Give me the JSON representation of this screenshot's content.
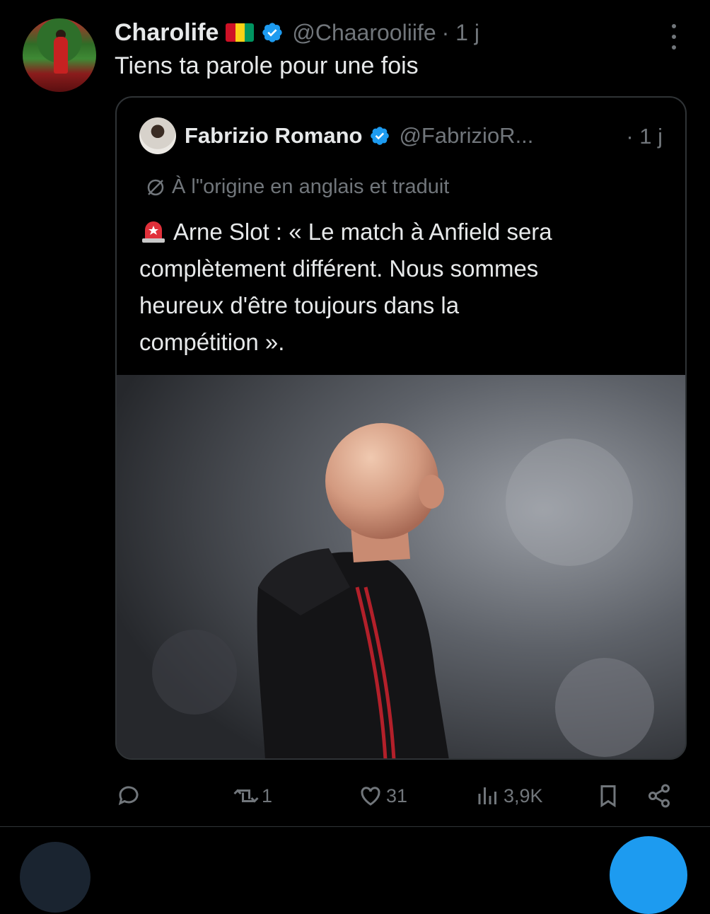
{
  "tweet": {
    "author_name": "Charolife",
    "author_handle": "@Chaarooliife",
    "time": "· 1 j",
    "text": "Tiens ta parole pour une fois",
    "flag_colors": [
      "#ce1126",
      "#fcd116",
      "#009460"
    ]
  },
  "quoted": {
    "author_name": "Fabrizio Romano",
    "author_handle": "@FabrizioR...",
    "time": "· 1 j",
    "translation_note": "À l\"origine en anglais et traduit",
    "text_lines": [
      "Arne Slot : « Le match à Anfield sera",
      "complètement différent. Nous sommes",
      "heureux d'être toujours dans la",
      "compétition »."
    ]
  },
  "actions": {
    "reply_count": "",
    "retweet_count": "1",
    "like_count": "31",
    "views_count": "3,9K"
  },
  "colors": {
    "background": "#000000",
    "text": "#e7e9ea",
    "muted": "#71767b",
    "border": "#2f3336",
    "verified": "#1d9bf0"
  }
}
